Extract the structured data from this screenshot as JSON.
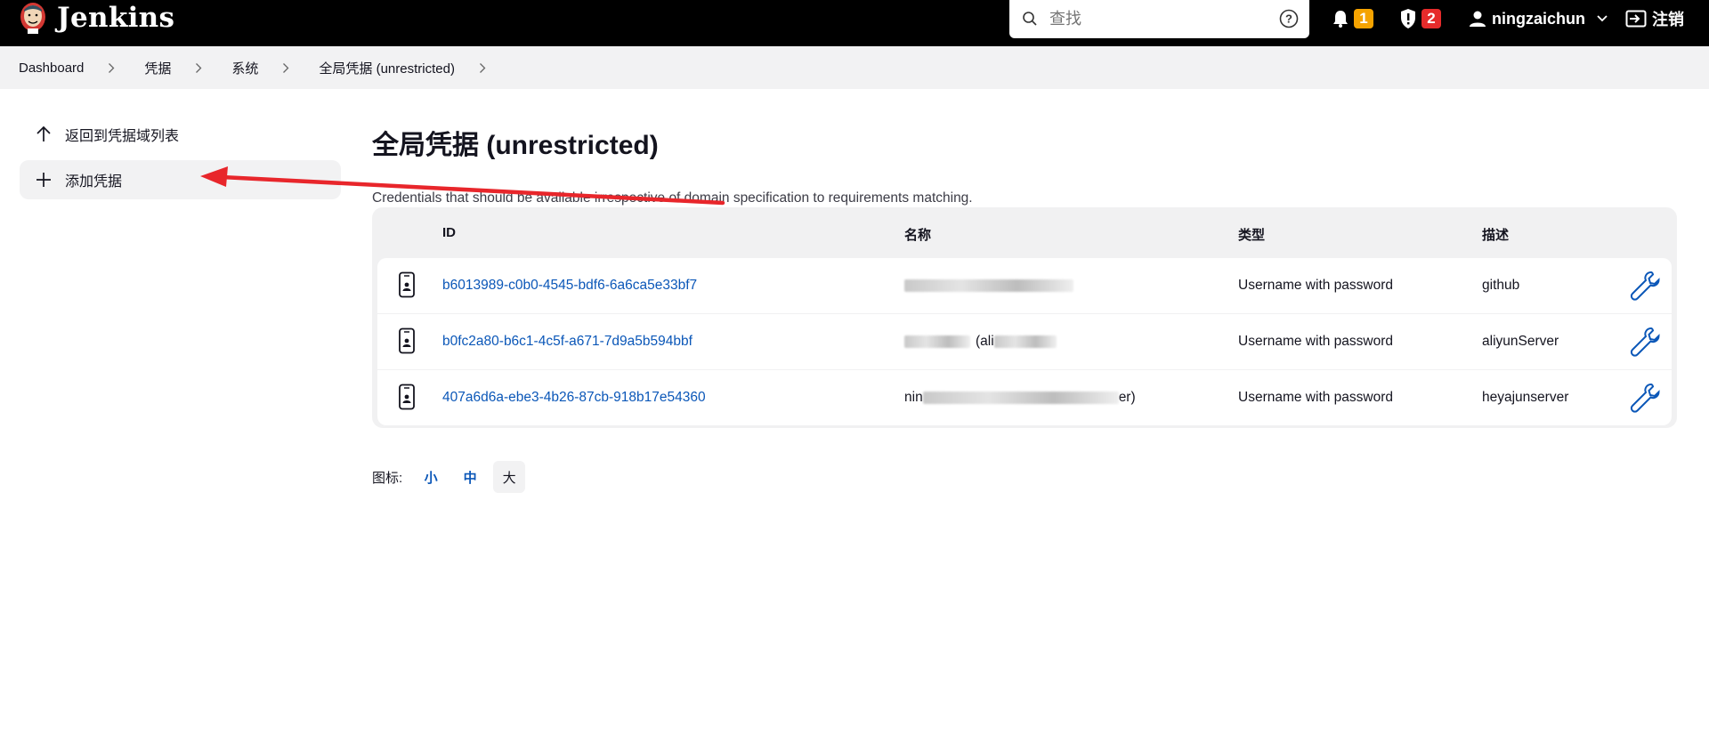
{
  "header": {
    "app_name": "Jenkins",
    "search": {
      "placeholder": "查找"
    },
    "notifications": {
      "count": "1"
    },
    "security": {
      "count": "2"
    },
    "user": {
      "name": "ningzaichun"
    },
    "logout_label": "注销"
  },
  "breadcrumb": [
    "Dashboard",
    "凭据",
    "系统",
    "全局凭据 (unrestricted)"
  ],
  "sidebar": {
    "items": [
      {
        "label": "返回到凭据域列表",
        "icon": "arrow-up-icon"
      },
      {
        "label": "添加凭据",
        "icon": "plus-icon"
      }
    ]
  },
  "main": {
    "title": "全局凭据 (unrestricted)",
    "description": "Credentials that should be available irrespective of domain specification to requirements matching.",
    "table": {
      "headers": [
        "ID",
        "名称",
        "类型",
        "描述"
      ],
      "rows": [
        {
          "id": "b6013989-c0b0-4545-bdf6-6a6ca5e33bf7",
          "name_prefix": "",
          "name_suffix": "",
          "type": "Username with password",
          "description": "github"
        },
        {
          "id": "b0fc2a80-b6c1-4c5f-a671-7d9a5b594bbf",
          "name_prefix": "",
          "name_suffix": "(ali",
          "type": "Username with password",
          "description": "aliyunServer"
        },
        {
          "id": "407a6d6a-ebe3-4b26-87cb-918b17e54360",
          "name_prefix": "nin",
          "name_suffix": "er)",
          "type": "Username with password",
          "description": "heyajunserver"
        }
      ]
    },
    "icon_size": {
      "label": "图标:",
      "options": [
        "小",
        "中",
        "大"
      ],
      "selected": "大"
    }
  },
  "colors": {
    "header_bg": "#000000",
    "link": "#0b57b8",
    "notification_badge": "#f5a300",
    "security_badge": "#e62b2b",
    "annotation_arrow": "#e8262b"
  }
}
